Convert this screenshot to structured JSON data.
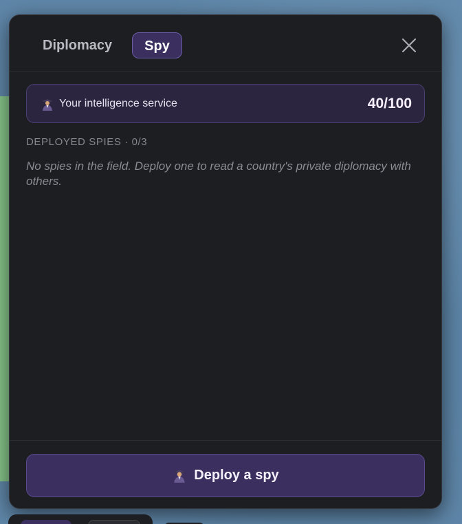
{
  "tabs": {
    "diplomacy_label": "Diplomacy",
    "spy_label": "Spy",
    "active": "Spy"
  },
  "intel": {
    "label": "Your intelligence service",
    "score": "40/100",
    "icon": "spy-icon"
  },
  "deployed": {
    "title": "DEPLOYED SPIES · 0/3",
    "empty_message": "No spies in the field. Deploy one to read a country's private diplomacy with others."
  },
  "deploy_button": {
    "label": "Deploy a spy",
    "icon": "spy-icon"
  },
  "close_icon": "close-icon",
  "colors": {
    "panel_bg": "#1d1e22",
    "accent": "#3a2f5e",
    "accent_border": "#6b5ca6",
    "card_bg": "#2c2540",
    "ocean": "#5f86a8",
    "land": "#86c58a"
  }
}
